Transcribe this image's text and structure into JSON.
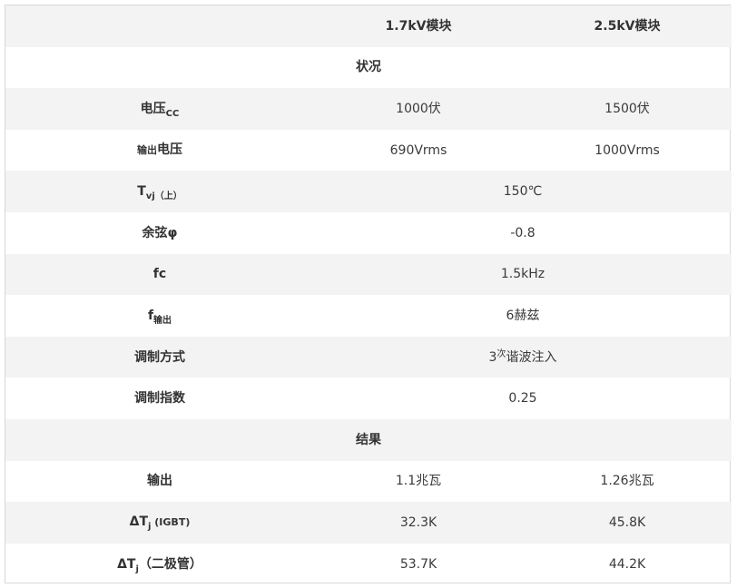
{
  "header": {
    "col1": "1.7kV模块",
    "col2": "2.5kV模块"
  },
  "conditions_title": "状况",
  "results_title": "结果",
  "rows": {
    "vdc": {
      "label_main": "电压",
      "label_sub": "CC",
      "v1": "1000伏",
      "v2": "1500伏"
    },
    "vout": {
      "label_pre": "输出",
      "label_main": "电压",
      "v1": "690Vrms",
      "v2": "1000Vrms"
    },
    "tvj": {
      "label_main": "T",
      "label_sub": "vj（上）",
      "value": "150℃"
    },
    "cos": {
      "label": "余弦φ",
      "value": "-0.8"
    },
    "fc": {
      "label": "fc",
      "value": "1.5kHz"
    },
    "fout": {
      "label_main": "f",
      "label_sub": "输出",
      "value": "6赫兹"
    },
    "mod": {
      "label": "调制方式",
      "value_pre": "3",
      "value_sup": "次",
      "value_post": "谐波注入"
    },
    "index": {
      "label": "调制指数",
      "value": "0.25"
    },
    "pout": {
      "label": "输出",
      "v1": "1.1兆瓦",
      "v2": "1.26兆瓦"
    },
    "dtj_igbt": {
      "label_main": "ΔT",
      "label_sub": "j",
      "label_post": " (IGBT)",
      "v1": "32.3K",
      "v2": "45.8K"
    },
    "dtj_diode": {
      "label_main": "ΔT",
      "label_sub": "j",
      "label_post": "（二极管）",
      "v1": "53.7K",
      "v2": "44.2K"
    }
  }
}
